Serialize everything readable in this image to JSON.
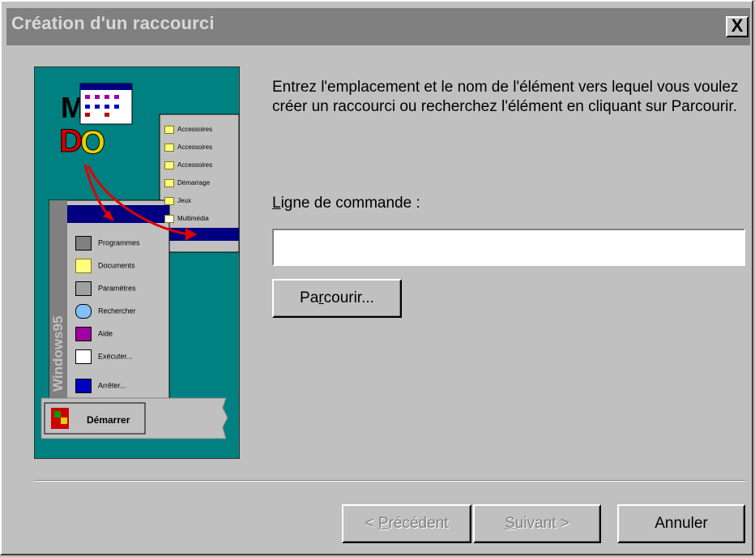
{
  "window": {
    "title": "Création d'un raccourci",
    "close_glyph": "X"
  },
  "intro_text": "Entrez l'emplacement et le nom de l'élément vers lequel vous voulez créer un raccourci ou recherchez l'élément en cliquant sur Parcourir.",
  "command_line": {
    "label_prefix": "L",
    "label_rest": "igne de commande :",
    "value": "",
    "placeholder": ""
  },
  "browse_button": {
    "pre": "Pa",
    "accel": "r",
    "post": "courir..."
  },
  "nav": {
    "back": {
      "pre": "< ",
      "accel": "P",
      "post": "récédent"
    },
    "next": {
      "accel": "S",
      "post": "uivant >"
    },
    "cancel": "Annuler"
  },
  "illustration": {
    "menu_items": [
      "Programmes",
      "Documents",
      "Paramètres",
      "Rechercher",
      "Aide",
      "Exécuter...",
      "Arrêter..."
    ],
    "sub_items": [
      "Accessoires",
      "Accessoires",
      "Accessoires",
      "Démarrage",
      "Jeux",
      "Multimédia"
    ],
    "sidebar_text": "Windows95",
    "start_label": "Démarrer"
  },
  "colors": {
    "face": "#c0c0c0",
    "titlebar": "#808080",
    "desktop": "#008080",
    "menu_highlight": "#000080",
    "arrow": "#e00000"
  }
}
